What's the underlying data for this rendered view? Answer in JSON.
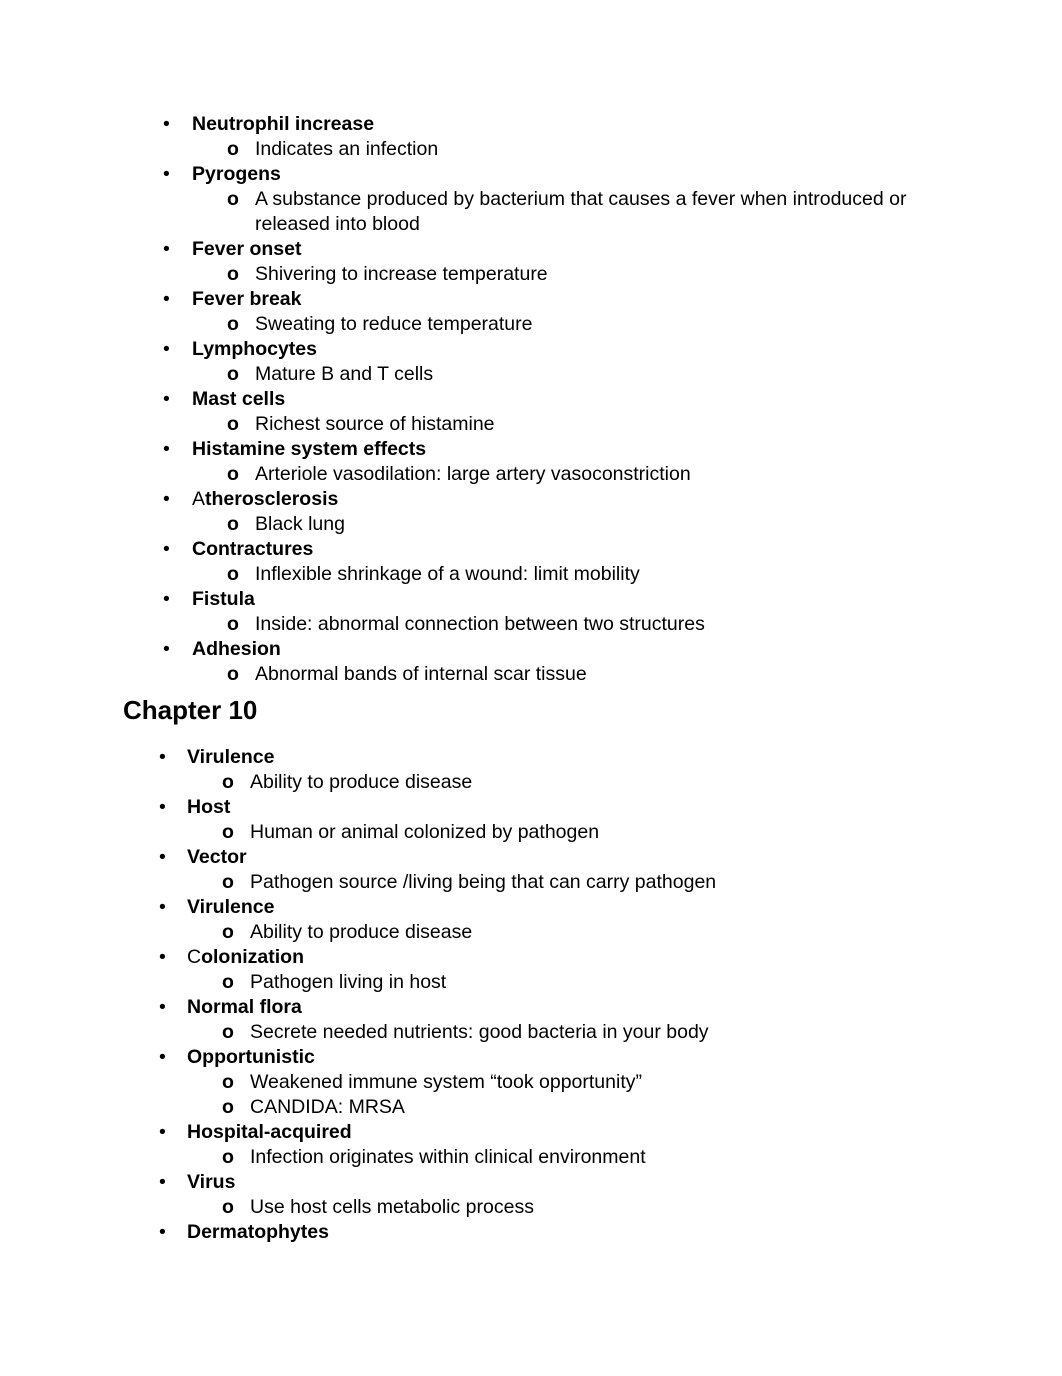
{
  "document": {
    "background_color": "#ffffff",
    "text_color": "#000000",
    "bullet_glyph": "•",
    "sub_bullet_glyph": "o"
  },
  "sections": [
    {
      "id": "section-chapter-9-continued",
      "heading": null,
      "items": [
        {
          "term": "Neutrophil increase",
          "term_lead_plain": "",
          "details": [
            "Indicates an infection"
          ]
        },
        {
          "term": "Pyrogens",
          "term_lead_plain": "",
          "details": [
            "A substance produced by bacterium that causes a fever when introduced or released into blood"
          ]
        },
        {
          "term": "Fever onset",
          "term_lead_plain": "",
          "details": [
            "Shivering to increase temperature"
          ]
        },
        {
          "term": "Fever break",
          "term_lead_plain": "",
          "details": [
            "Sweating to reduce temperature"
          ]
        },
        {
          "term": "Lymphocytes",
          "term_lead_plain": "",
          "details": [
            "Mature B and T cells"
          ]
        },
        {
          "term": "Mast cells",
          "term_lead_plain": "",
          "details": [
            "Richest source of histamine"
          ]
        },
        {
          "term": "Histamine system effects",
          "term_lead_plain": "",
          "details": [
            "Arteriole vasodilation: large artery vasoconstriction"
          ]
        },
        {
          "term": "therosclerosis",
          "term_lead_plain": "A",
          "details": [
            "Black lung"
          ]
        },
        {
          "term": "Contractures",
          "term_lead_plain": "",
          "details": [
            "Inflexible shrinkage of a wound: limit mobility"
          ]
        },
        {
          "term": "Fistula",
          "term_lead_plain": "",
          "details": [
            "Inside: abnormal connection between two structures"
          ]
        },
        {
          "term": "Adhesion",
          "term_lead_plain": "",
          "details": [
            "Abnormal bands of internal scar tissue"
          ]
        }
      ]
    },
    {
      "id": "section-chapter-10",
      "heading": "Chapter 10",
      "items": [
        {
          "term": "Virulence",
          "term_lead_plain": "",
          "details": [
            "Ability to produce disease"
          ]
        },
        {
          "term": "Host",
          "term_lead_plain": "",
          "details": [
            "Human or animal colonized by pathogen"
          ]
        },
        {
          "term": "Vector",
          "term_lead_plain": "",
          "details": [
            "Pathogen source /living being that can carry pathogen"
          ]
        },
        {
          "term": "Virulence",
          "term_lead_plain": "",
          "details": [
            "Ability to produce disease"
          ]
        },
        {
          "term": "olonization",
          "term_lead_plain": "C",
          "details": [
            "Pathogen living in host"
          ]
        },
        {
          "term": "Normal flora",
          "term_lead_plain": "",
          "details": [
            "Secrete needed nutrients: good bacteria in your body"
          ]
        },
        {
          "term": "Opportunistic",
          "term_lead_plain": "",
          "details": [
            "Weakened immune system “took opportunity”",
            "CANDIDA: MRSA"
          ]
        },
        {
          "term": "Hospital-acquired",
          "term_lead_plain": "",
          "details": [
            "Infection originates within clinical environment"
          ]
        },
        {
          "term": "Virus",
          "term_lead_plain": "",
          "details": [
            "Use host cells metabolic process"
          ]
        },
        {
          "term": "Dermatophytes",
          "term_lead_plain": "",
          "details": []
        }
      ]
    }
  ]
}
